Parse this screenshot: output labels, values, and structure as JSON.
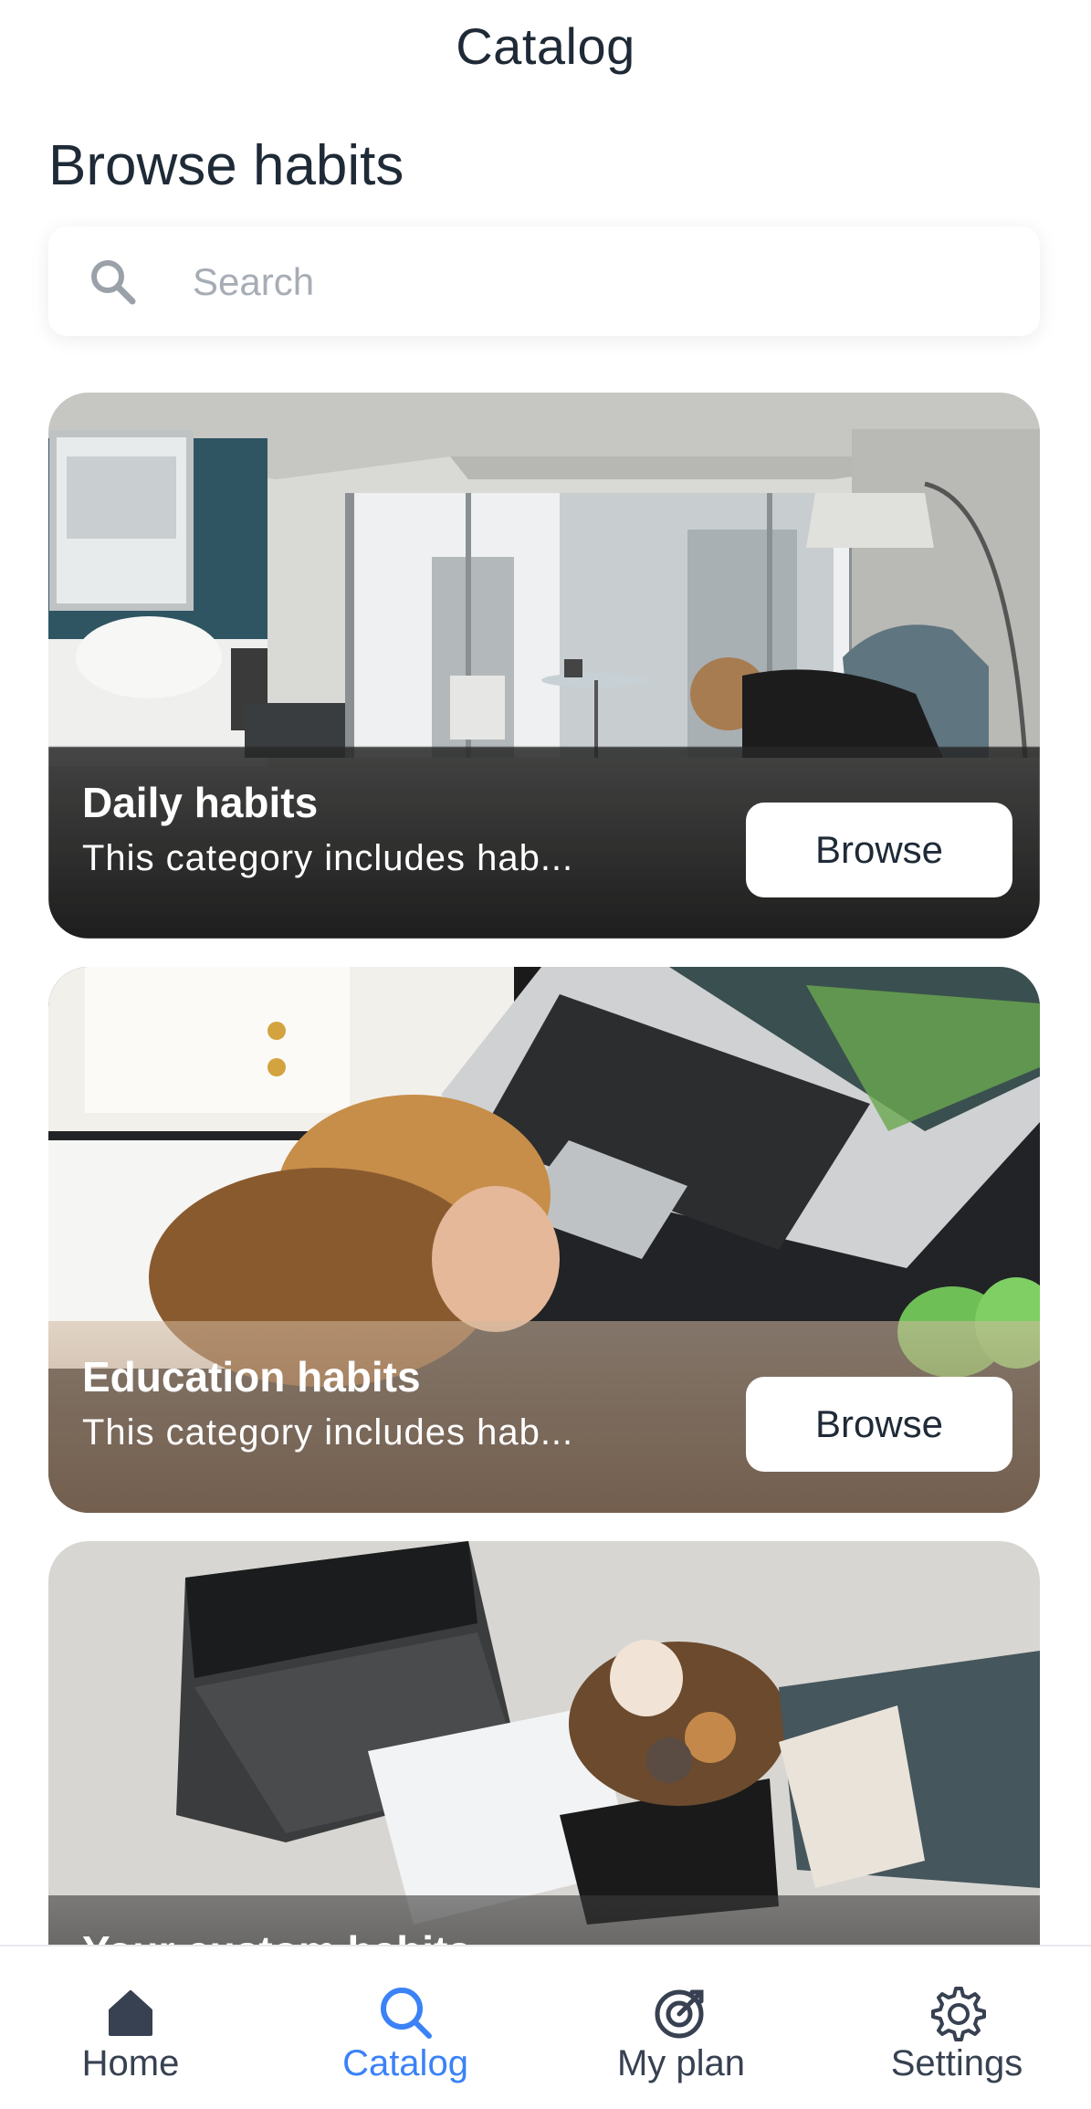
{
  "header": {
    "title": "Catalog"
  },
  "main": {
    "section_title": "Browse habits",
    "search": {
      "placeholder": "Search",
      "value": ""
    },
    "categories": [
      {
        "title": "Daily habits",
        "subtitle": "This category includes hab...",
        "button_label": "Browse"
      },
      {
        "title": "Education habits",
        "subtitle": "This category includes hab...",
        "button_label": "Browse"
      },
      {
        "title": "Your custom habits",
        "subtitle": "",
        "button_label": ""
      }
    ]
  },
  "tabbar": {
    "active": "Catalog",
    "accent_color": "#3b82f6",
    "items": [
      {
        "label": "Home",
        "icon": "home-icon"
      },
      {
        "label": "Catalog",
        "icon": "search-icon"
      },
      {
        "label": "My plan",
        "icon": "target-icon"
      },
      {
        "label": "Settings",
        "icon": "gear-icon"
      }
    ]
  }
}
